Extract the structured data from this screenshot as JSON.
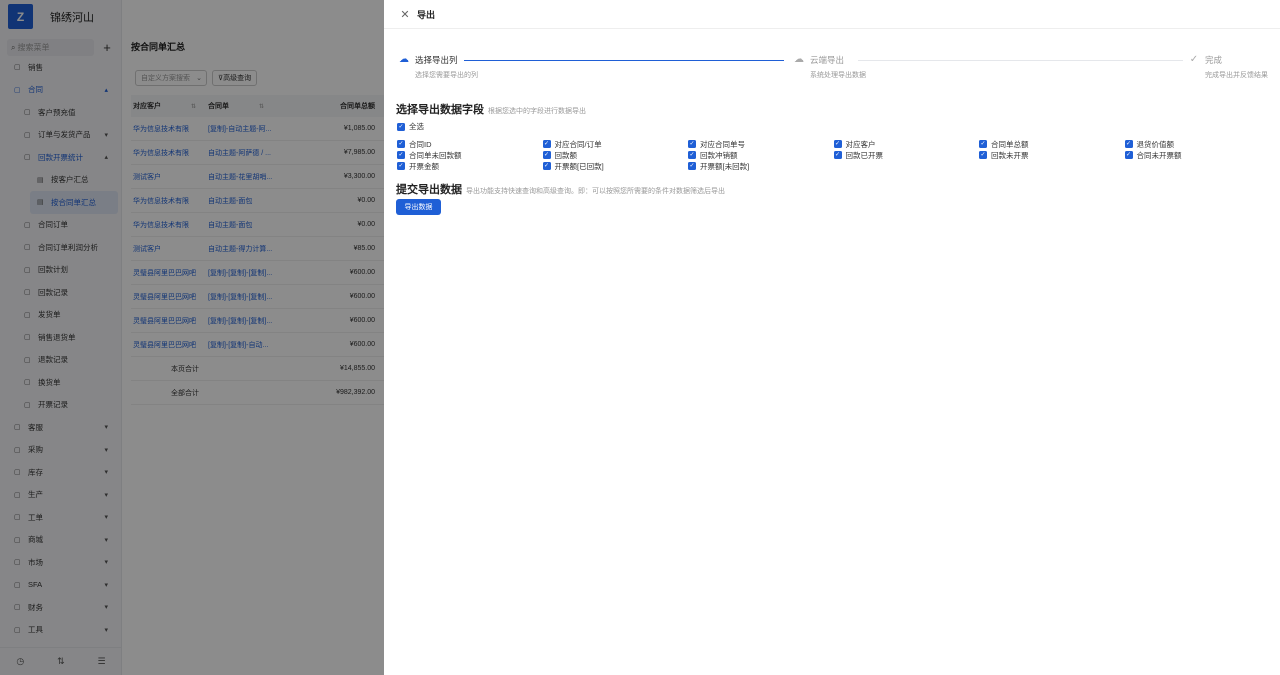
{
  "app": {
    "brand_logo": "Z",
    "brand_name": "锦绣河山",
    "search_placeholder": "搜索菜单",
    "plus": "+"
  },
  "sidebar": {
    "items": [
      {
        "label": "销售",
        "icon": "sales-icon",
        "chev": "",
        "type": "top"
      },
      {
        "label": "合同",
        "icon": "contract-icon",
        "chev": "▴",
        "type": "open"
      },
      {
        "label": "客户预充值",
        "icon": "doc-icon",
        "chev": "",
        "type": "sub"
      },
      {
        "label": "订单与发货产品",
        "icon": "doc-icon",
        "chev": "▾",
        "type": "sub"
      },
      {
        "label": "回款开票统计",
        "icon": "doc-icon",
        "chev": "▴",
        "type": "subopen"
      },
      {
        "label": "按客户汇总",
        "icon": "list-icon",
        "chev": "",
        "type": "sub2"
      },
      {
        "label": "按合同单汇总",
        "icon": "list-icon",
        "chev": "",
        "type": "active"
      },
      {
        "label": "合同订单",
        "icon": "doc-icon",
        "chev": "",
        "type": "sub"
      },
      {
        "label": "合同订单利润分析",
        "icon": "doc-icon",
        "chev": "",
        "type": "sub"
      },
      {
        "label": "回款计划",
        "icon": "doc-icon",
        "chev": "",
        "type": "sub"
      },
      {
        "label": "回款记录",
        "icon": "doc-icon",
        "chev": "",
        "type": "sub"
      },
      {
        "label": "发货单",
        "icon": "doc-icon",
        "chev": "",
        "type": "sub"
      },
      {
        "label": "销售退货单",
        "icon": "doc-icon",
        "chev": "",
        "type": "sub"
      },
      {
        "label": "退款记录",
        "icon": "refund-icon",
        "chev": "",
        "type": "sub"
      },
      {
        "label": "换货单",
        "icon": "doc-icon",
        "chev": "",
        "type": "sub"
      },
      {
        "label": "开票记录",
        "icon": "invoice-icon",
        "chev": "",
        "type": "sub"
      },
      {
        "label": "客服",
        "icon": "service-icon",
        "chev": "▾",
        "type": "top"
      },
      {
        "label": "采购",
        "icon": "purchase-icon",
        "chev": "▾",
        "type": "top"
      },
      {
        "label": "库存",
        "icon": "stock-icon",
        "chev": "▾",
        "type": "top"
      },
      {
        "label": "生产",
        "icon": "production-icon",
        "chev": "▾",
        "type": "top"
      },
      {
        "label": "工单",
        "icon": "ticket-icon",
        "chev": "▾",
        "type": "top"
      },
      {
        "label": "商城",
        "icon": "mall-icon",
        "chev": "▾",
        "type": "top"
      },
      {
        "label": "市场",
        "icon": "market-icon",
        "chev": "▾",
        "type": "top"
      },
      {
        "label": "SFA",
        "icon": "sfa-icon",
        "chev": "▾",
        "type": "top"
      },
      {
        "label": "财务",
        "icon": "finance-icon",
        "chev": "▾",
        "type": "top"
      },
      {
        "label": "工具",
        "icon": "tools-icon",
        "chev": "▾",
        "type": "top"
      }
    ]
  },
  "main": {
    "title": "按合同单汇总",
    "filter_placeholder": "自定义方案搜索",
    "advanced_search": "高级查询",
    "columns": [
      "对应客户",
      "合同单",
      "合同单总额"
    ],
    "rows": [
      {
        "customer": "华为信息技术有限",
        "contract": "[复制]-自动主题-阿...",
        "amount": "¥1,085.00"
      },
      {
        "customer": "华为信息技术有限",
        "contract": "自动主题-阿萨德 / ...",
        "amount": "¥7,985.00"
      },
      {
        "customer": "测试客户",
        "contract": "自动主题-花里胡哨...",
        "amount": "¥3,300.00"
      },
      {
        "customer": "华为信息技术有限",
        "contract": "自动主题-面包",
        "amount": "¥0.00"
      },
      {
        "customer": "华为信息技术有限",
        "contract": "自动主题-面包",
        "amount": "¥0.00"
      },
      {
        "customer": "测试客户",
        "contract": "自动主题-得力计算...",
        "amount": "¥85.00"
      },
      {
        "customer": "灵璧县阿里巴巴网吧",
        "contract": "[复制]-[复制]-[复制]...",
        "amount": "¥600.00"
      },
      {
        "customer": "灵璧县阿里巴巴网吧",
        "contract": "[复制]-[复制]-[复制]...",
        "amount": "¥600.00"
      },
      {
        "customer": "灵璧县阿里巴巴网吧",
        "contract": "[复制]-[复制]-[复制]...",
        "amount": "¥600.00"
      },
      {
        "customer": "灵璧县阿里巴巴网吧",
        "contract": "[复制]-[复制]-自动...",
        "amount": "¥600.00"
      }
    ],
    "page_total_label": "本页合计",
    "page_total": "¥14,855.00",
    "all_total_label": "全部合计",
    "all_total": "¥982,392.00"
  },
  "drawer": {
    "title": "导出",
    "steps": [
      {
        "title": "选择导出列",
        "desc": "选择您需要导出的列"
      },
      {
        "title": "云端导出",
        "desc": "系统处理导出数据"
      },
      {
        "title": "完成",
        "desc": "完成导出并反馈结果"
      }
    ],
    "section1_title": "选择导出数据字段",
    "section1_hint": "根据您选中的字段进行数据导出",
    "select_all": "全选",
    "fields": [
      "合同ID",
      "对应合同/订单",
      "对应合同单号",
      "对应客户",
      "合同单总额",
      "退货价值额",
      "合同单未回款额",
      "回款额",
      "回款冲销额",
      "回款已开票",
      "回款未开票",
      "合同未开票额",
      "开票金额",
      "开票额[已回款]",
      "开票额[未回款]"
    ],
    "section2_title": "提交导出数据",
    "section2_hint": "导出功能支持快速查询和高级查询。即：可以按照您所需要的条件对数据筛选后导出",
    "export_button": "导出数据"
  }
}
